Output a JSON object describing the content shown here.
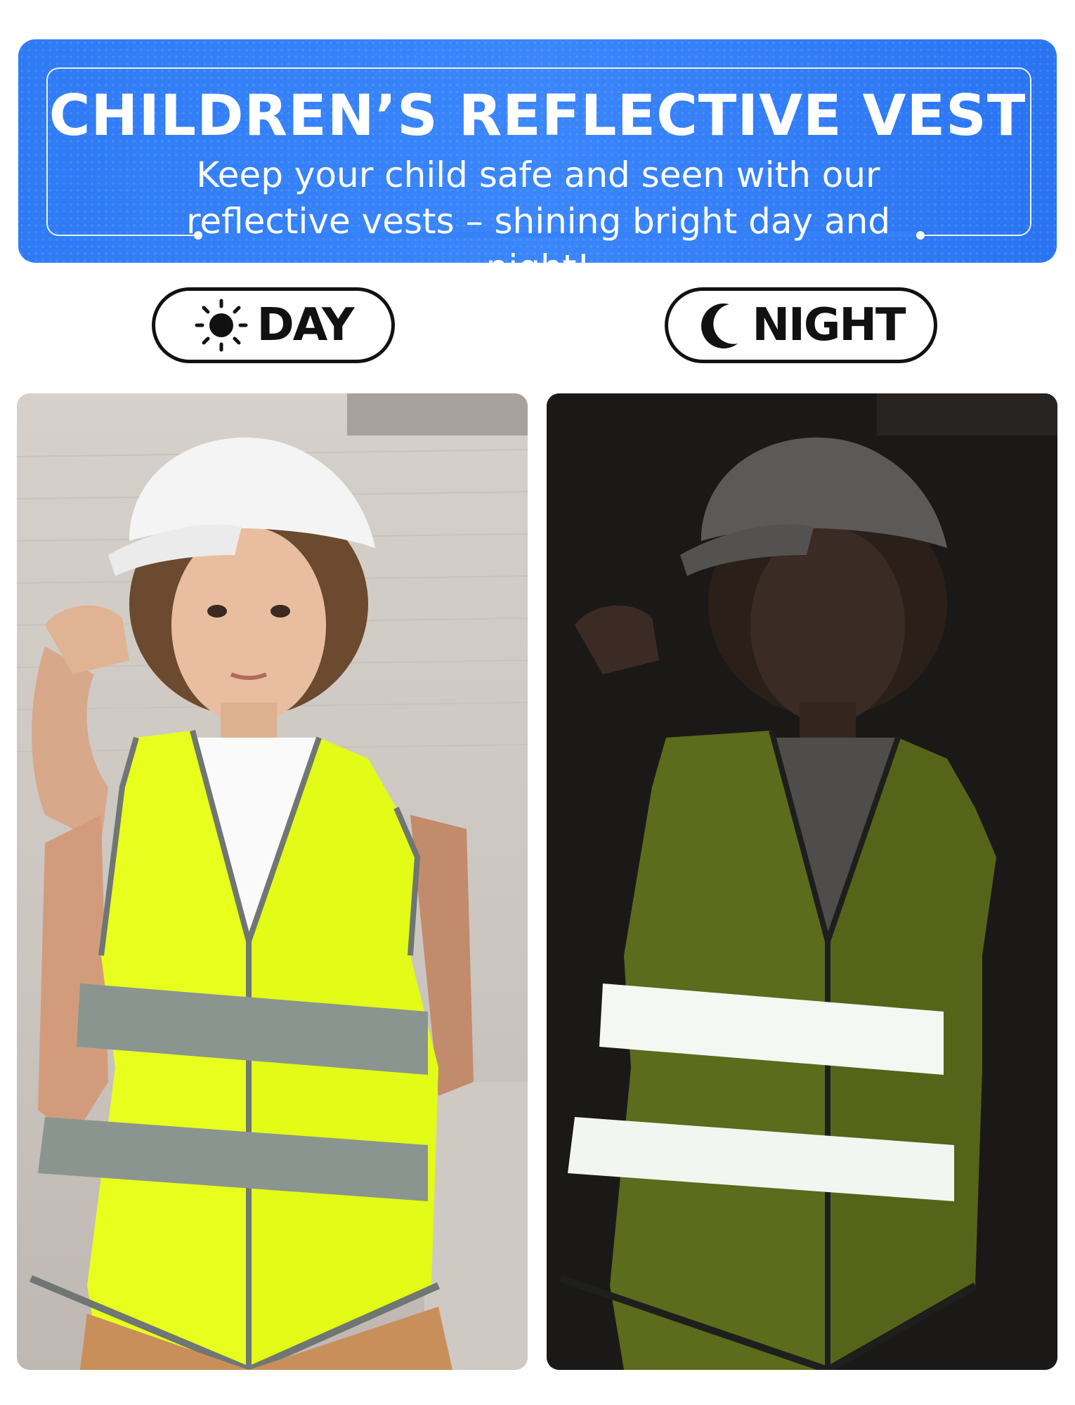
{
  "banner": {
    "title": "CHILDREN’S REFLECTIVE VEST",
    "subtitle": "Keep your child safe and seen with our reflective vests – shining bright day and night!"
  },
  "labels": {
    "day": "DAY",
    "night": "NIGHT",
    "day_icon": "sun-icon",
    "night_icon": "moon-icon"
  },
  "colors": {
    "banner_blue": "#2f7bf5",
    "vest_yellow": "#e8ff1e",
    "reflective_stripe": "#8a9590"
  }
}
